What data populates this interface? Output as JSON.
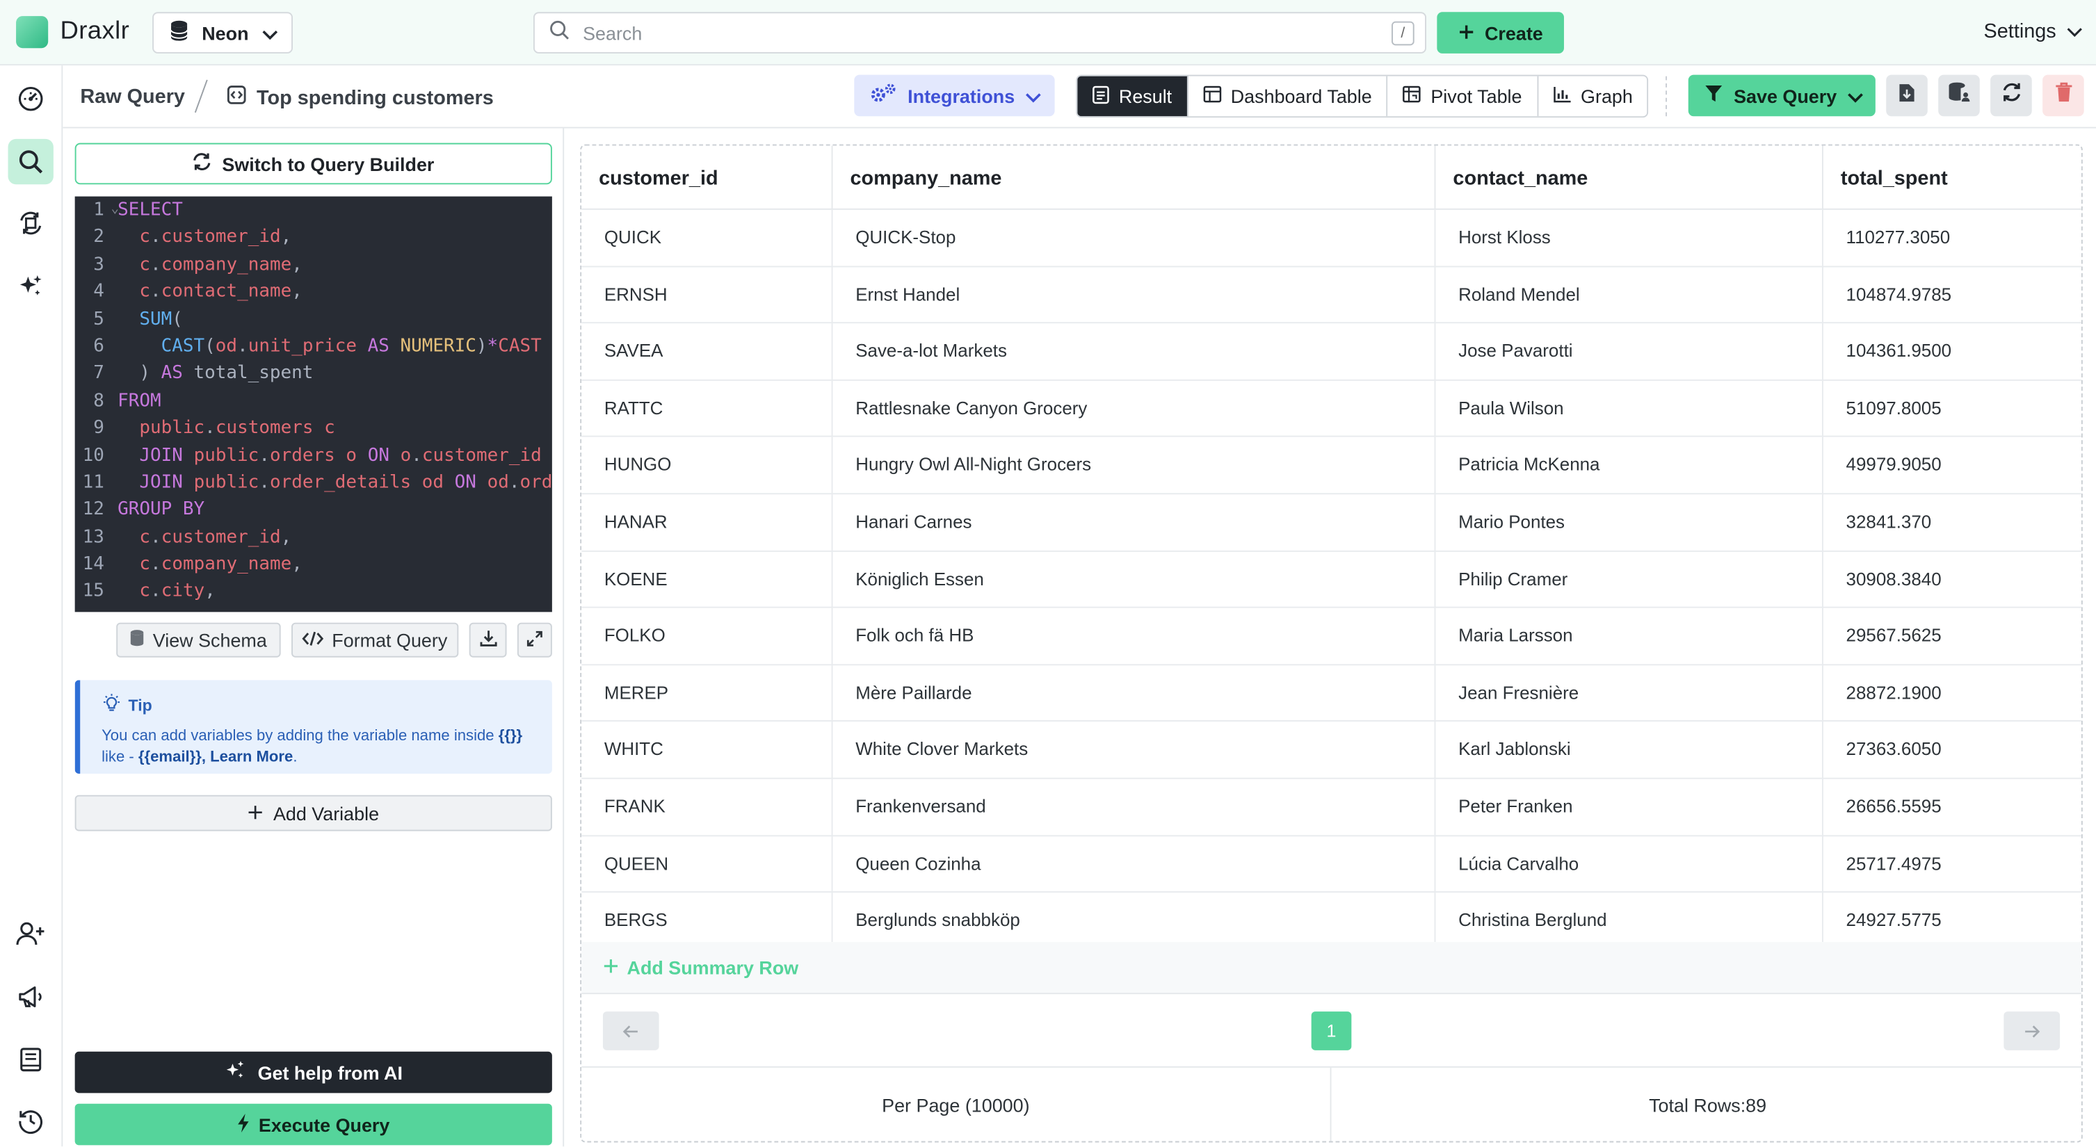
{
  "app": {
    "brand": "Draxlr"
  },
  "topbar": {
    "database": "Neon",
    "search_placeholder": "Search",
    "search_shortcut": "/",
    "create_label": "Create",
    "settings_label": "Settings"
  },
  "rail": {
    "icons": [
      "dashboard-icon",
      "search-icon",
      "sync-icon",
      "sparkle-icon",
      "add-user-icon",
      "megaphone-icon",
      "book-icon",
      "history-icon"
    ],
    "active": "search-icon"
  },
  "subheader": {
    "breadcrumb_root": "Raw Query",
    "query_name": "Top spending customers",
    "integrations_label": "Integrations",
    "view_tabs": [
      "Result",
      "Dashboard Table",
      "Pivot Table",
      "Graph"
    ],
    "active_tab": "Result",
    "save_label": "Save Query"
  },
  "editor": {
    "switch_label": "Switch to Query Builder",
    "view_schema_label": "View Schema",
    "format_label": "Format Query",
    "tip_title": "Tip",
    "tip_text_1": "You can add variables by adding the variable name inside",
    "tip_braces": "{{}}",
    "tip_text_2": "like -",
    "tip_example": "{{email}},",
    "tip_learn_more": "Learn More",
    "add_variable_label": "Add Variable",
    "ai_help_label": "Get help from AI",
    "execute_label": "Execute Query",
    "code_lines": [
      {
        "n": "1",
        "parts": [
          [
            "kw",
            "SELECT"
          ]
        ]
      },
      {
        "n": "2",
        "parts": [
          [
            "code",
            "  "
          ],
          [
            "id",
            "c"
          ],
          [
            "code",
            "."
          ],
          [
            "id",
            "customer_id"
          ],
          [
            "code",
            ","
          ]
        ]
      },
      {
        "n": "3",
        "parts": [
          [
            "code",
            "  "
          ],
          [
            "id",
            "c"
          ],
          [
            "code",
            "."
          ],
          [
            "id",
            "company_name"
          ],
          [
            "code",
            ","
          ]
        ]
      },
      {
        "n": "4",
        "parts": [
          [
            "code",
            "  "
          ],
          [
            "id",
            "c"
          ],
          [
            "code",
            "."
          ],
          [
            "id",
            "contact_name"
          ],
          [
            "code",
            ","
          ]
        ]
      },
      {
        "n": "5",
        "parts": [
          [
            "code",
            "  "
          ],
          [
            "fn",
            "SUM"
          ],
          [
            "code",
            "("
          ]
        ]
      },
      {
        "n": "6",
        "parts": [
          [
            "code",
            "    "
          ],
          [
            "fn",
            "CAST"
          ],
          [
            "code",
            "("
          ],
          [
            "id",
            "od"
          ],
          [
            "code",
            "."
          ],
          [
            "id",
            "unit_price"
          ],
          [
            "code",
            " "
          ],
          [
            "kw",
            "AS"
          ],
          [
            "code",
            " "
          ],
          [
            "ty",
            "NUMERIC"
          ],
          [
            "code",
            ")"
          ],
          [
            "kw",
            "*"
          ],
          [
            "id",
            "CAST"
          ]
        ]
      },
      {
        "n": "7",
        "parts": [
          [
            "code",
            "  ) "
          ],
          [
            "kw",
            "AS"
          ],
          [
            "code",
            " total_spent"
          ]
        ]
      },
      {
        "n": "8",
        "parts": [
          [
            "kw",
            "FROM"
          ]
        ]
      },
      {
        "n": "9",
        "parts": [
          [
            "code",
            "  "
          ],
          [
            "id",
            "public"
          ],
          [
            "code",
            "."
          ],
          [
            "id",
            "customers"
          ],
          [
            "code",
            " "
          ],
          [
            "id",
            "c"
          ]
        ]
      },
      {
        "n": "10",
        "parts": [
          [
            "code",
            "  "
          ],
          [
            "kw",
            "JOIN"
          ],
          [
            "code",
            " "
          ],
          [
            "id",
            "public"
          ],
          [
            "code",
            "."
          ],
          [
            "id",
            "orders"
          ],
          [
            "code",
            " "
          ],
          [
            "id",
            "o"
          ],
          [
            "code",
            " "
          ],
          [
            "kw",
            "ON"
          ],
          [
            "code",
            " "
          ],
          [
            "id",
            "o"
          ],
          [
            "code",
            "."
          ],
          [
            "id",
            "customer_id"
          ]
        ]
      },
      {
        "n": "11",
        "parts": [
          [
            "code",
            "  "
          ],
          [
            "kw",
            "JOIN"
          ],
          [
            "code",
            " "
          ],
          [
            "id",
            "public"
          ],
          [
            "code",
            "."
          ],
          [
            "id",
            "order_details"
          ],
          [
            "code",
            " "
          ],
          [
            "id",
            "od"
          ],
          [
            "code",
            " "
          ],
          [
            "kw",
            "ON"
          ],
          [
            "code",
            " "
          ],
          [
            "id",
            "od"
          ],
          [
            "code",
            "."
          ],
          [
            "id",
            "order_id"
          ]
        ]
      },
      {
        "n": "12",
        "parts": [
          [
            "kw",
            "GROUP BY"
          ]
        ]
      },
      {
        "n": "13",
        "parts": [
          [
            "code",
            "  "
          ],
          [
            "id",
            "c"
          ],
          [
            "code",
            "."
          ],
          [
            "id",
            "customer_id"
          ],
          [
            "code",
            ","
          ]
        ]
      },
      {
        "n": "14",
        "parts": [
          [
            "code",
            "  "
          ],
          [
            "id",
            "c"
          ],
          [
            "code",
            "."
          ],
          [
            "id",
            "company_name"
          ],
          [
            "code",
            ","
          ]
        ]
      },
      {
        "n": "15",
        "parts": [
          [
            "code",
            "  "
          ],
          [
            "id",
            "c"
          ],
          [
            "code",
            "."
          ],
          [
            "id",
            "city"
          ],
          [
            "code",
            ","
          ]
        ]
      }
    ]
  },
  "table": {
    "columns": [
      "customer_id",
      "company_name",
      "contact_name",
      "total_spent"
    ],
    "rows": [
      [
        "QUICK",
        "QUICK-Stop",
        "Horst Kloss",
        "110277.3050"
      ],
      [
        "ERNSH",
        "Ernst Handel",
        "Roland Mendel",
        "104874.9785"
      ],
      [
        "SAVEA",
        "Save-a-lot Markets",
        "Jose Pavarotti",
        "104361.9500"
      ],
      [
        "RATTC",
        "Rattlesnake Canyon Grocery",
        "Paula Wilson",
        "51097.8005"
      ],
      [
        "HUNGO",
        "Hungry Owl All-Night Grocers",
        "Patricia McKenna",
        "49979.9050"
      ],
      [
        "HANAR",
        "Hanari Carnes",
        "Mario Pontes",
        "32841.370"
      ],
      [
        "KOENE",
        "Königlich Essen",
        "Philip Cramer",
        "30908.3840"
      ],
      [
        "FOLKO",
        "Folk och fä HB",
        "Maria Larsson",
        "29567.5625"
      ],
      [
        "MEREP",
        "Mère Paillarde",
        "Jean Fresnière",
        "28872.1900"
      ],
      [
        "WHITC",
        "White Clover Markets",
        "Karl Jablonski",
        "27363.6050"
      ],
      [
        "FRANK",
        "Frankenversand",
        "Peter Franken",
        "26656.5595"
      ],
      [
        "QUEEN",
        "Queen Cozinha",
        "Lúcia Carvalho",
        "25717.4975"
      ],
      [
        "BERGS",
        "Berglunds snabbköp",
        "Christina Berglund",
        "24927.5775"
      ]
    ],
    "add_summary_label": "Add Summary Row",
    "current_page": "1",
    "per_page_label": "Per Page (10000)",
    "total_rows_label": "Total Rows:89"
  },
  "colors": {
    "accent": "#55d49b",
    "dark": "#22272e",
    "integrations": "#3f51d6",
    "tip": "#2a5fb5"
  }
}
